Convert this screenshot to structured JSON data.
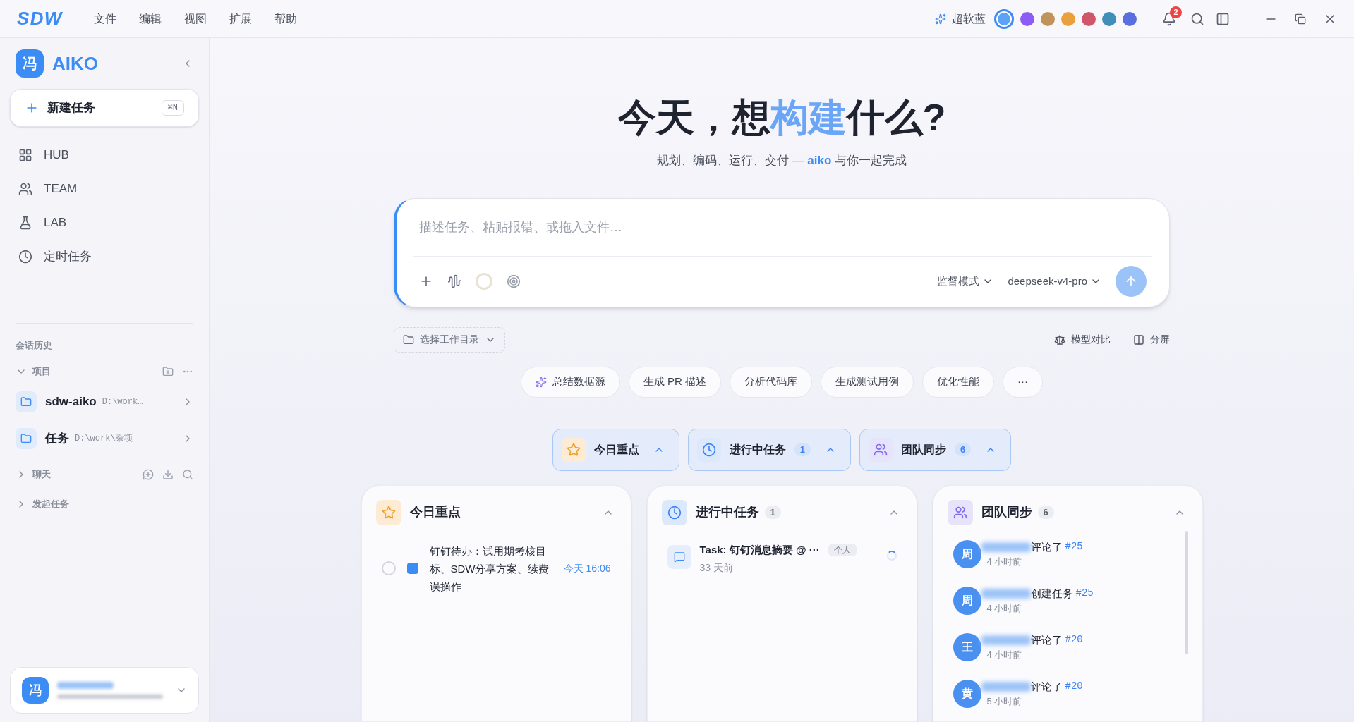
{
  "app": {
    "logo": "SDW"
  },
  "menu": [
    "文件",
    "编辑",
    "视图",
    "扩展",
    "帮助"
  ],
  "theme": {
    "label": "超软蓝",
    "swatches": [
      {
        "color": "#5ea2f7",
        "selected": true
      },
      {
        "color": "#8b5cf6",
        "selected": false
      },
      {
        "color": "#c0935a",
        "selected": false
      },
      {
        "color": "#e9a23b",
        "selected": false
      },
      {
        "color": "#d0566a",
        "selected": false
      },
      {
        "color": "#3f8fb8",
        "selected": false
      },
      {
        "color": "#5b6ee0",
        "selected": false
      }
    ]
  },
  "notifications": {
    "count": "2"
  },
  "sidebar": {
    "avatar": "冯",
    "brand": "AIKO",
    "new_task": {
      "label": "新建任务",
      "shortcut": "⌘N"
    },
    "nav": [
      {
        "kind": "hub",
        "label": "HUB"
      },
      {
        "kind": "team",
        "label": "TEAM"
      },
      {
        "kind": "lab",
        "label": "LAB"
      },
      {
        "kind": "clock",
        "label": "定时任务"
      }
    ],
    "history_title": "会话历史",
    "groups": [
      {
        "label": "项目",
        "expanded": true,
        "kind": "projects",
        "items": [
          {
            "name": "sdw-aiko",
            "path": "D:\\work…"
          },
          {
            "name": "任务",
            "path": "D:\\work\\杂项"
          }
        ]
      },
      {
        "label": "聊天",
        "expanded": false,
        "kind": "chat"
      },
      {
        "label": "发起任务",
        "expanded": false,
        "kind": "plain"
      }
    ],
    "user": {
      "avatar": "冯"
    }
  },
  "hero": {
    "title_before": "今天，想",
    "title_highlight": "构建",
    "title_after": "什么?",
    "subtitle_before": "规划、编码、运行、交付 — ",
    "subtitle_brand": "aiko",
    "subtitle_after": " 与你一起完成"
  },
  "composer": {
    "placeholder": "描述任务、粘贴报错、或拖入文件…",
    "mode": "监督模式",
    "model": "deepseek-v4-pro"
  },
  "workdir": "选择工作目录",
  "actions": [
    {
      "kind": "compare",
      "label": "模型对比"
    },
    {
      "kind": "split",
      "label": "分屏"
    }
  ],
  "chips": [
    {
      "label": "总结数据源",
      "kind": "icon"
    },
    {
      "label": "生成 PR 描述",
      "kind": "plain"
    },
    {
      "label": "分析代码库",
      "kind": "plain"
    },
    {
      "label": "生成测试用例",
      "kind": "plain"
    },
    {
      "label": "优化性能",
      "kind": "plain"
    },
    {
      "label": "···",
      "kind": "more"
    }
  ],
  "toggles": [
    {
      "kind": "star",
      "label": "今日重点",
      "expanded": true
    },
    {
      "kind": "clock",
      "label": "进行中任务",
      "count": "1",
      "expanded": true
    },
    {
      "kind": "team",
      "label": "团队同步",
      "count": "6",
      "expanded": true
    }
  ],
  "cards": [
    {
      "kind": "star",
      "title": "今日重点",
      "expanded": true,
      "todos": [
        {
          "text": "钉钉待办：试用期考核目标、SDW分享方案、续费误操作",
          "time": "今天 16:06",
          "checked": false
        }
      ]
    },
    {
      "kind": "clock",
      "title": "进行中任务",
      "count": "1",
      "expanded": true,
      "tasks": [
        {
          "title": "Task: 钉钉消息摘要 @ ···",
          "tag": "个人",
          "time": "33 天前"
        }
      ]
    },
    {
      "kind": "team",
      "title": "团队同步",
      "count": "6",
      "expanded": true,
      "events": [
        {
          "avatar": "周",
          "action": "评论了",
          "ref": "#25",
          "time": "4 小时前"
        },
        {
          "avatar": "周",
          "action": "创建任务",
          "ref": "#25",
          "time": "4 小时前"
        },
        {
          "avatar": "王",
          "action": "评论了",
          "ref": "#20",
          "time": "4 小时前"
        },
        {
          "avatar": "黄",
          "action": "评论了",
          "ref": "#20",
          "time": "5 小时前"
        }
      ]
    }
  ]
}
